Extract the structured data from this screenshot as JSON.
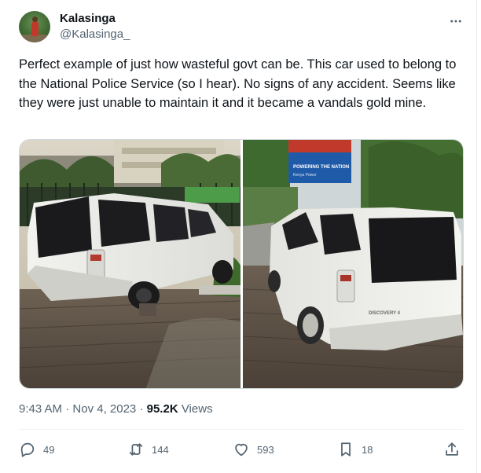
{
  "author": {
    "display_name": "Kalasinga",
    "handle": "@Kalasinga_"
  },
  "tweet": {
    "text": "Perfect example of just how wasteful govt can be. This car used to belong to the National Police Service (so I hear). No signs of any accident. Seems like they were just unable to maintain it and it became a vandals gold mine.",
    "time": "9:43 AM",
    "separator": "·",
    "date": "Nov 4, 2023",
    "views_count": "95.2K",
    "views_label": "Views"
  },
  "media": {
    "billboard_text": "POWERING THE NATION",
    "billboard_subtext": "Kenya Power",
    "rear_badge": "DISCOVERY 4"
  },
  "actions": {
    "replies": "49",
    "reposts": "144",
    "likes": "593",
    "bookmarks": "18"
  },
  "icons": {
    "more": "more-options-icon",
    "reply": "reply-icon",
    "repost": "repost-icon",
    "like": "like-icon",
    "bookmark": "bookmark-icon",
    "share": "share-icon"
  },
  "colors": {
    "text_primary": "#0f1419",
    "text_secondary": "#536471",
    "divider": "#eff3f4"
  }
}
